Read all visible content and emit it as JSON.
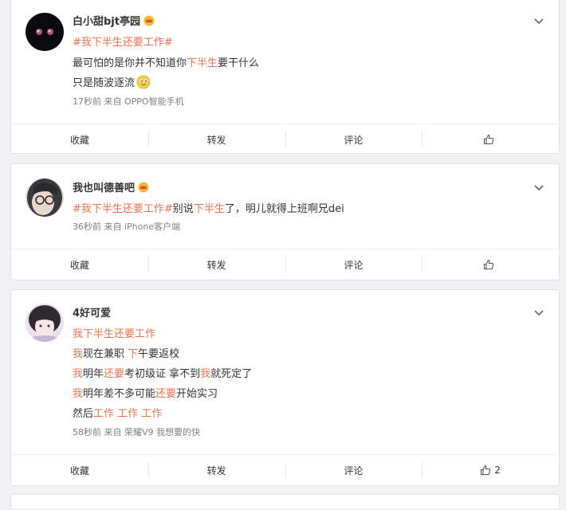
{
  "posts": [
    {
      "name": "白小甜bjt亭园",
      "lines": [
        [
          {
            "t": "#我下半生还要工作#",
            "hl": true
          }
        ],
        [
          {
            "t": "最可怕的是你并不知道你",
            "hl": false
          },
          {
            "t": "下半生",
            "hl": true
          },
          {
            "t": "要干什么",
            "hl": false
          }
        ],
        [
          {
            "t": "只是随波逐流",
            "hl": false
          }
        ]
      ],
      "meta": "17秒前 来自 OPPO智能手机",
      "actions": {
        "collect": "收藏",
        "repost": "转发",
        "comment": "评论",
        "like_count": ""
      }
    },
    {
      "name": "我也叫德善吧",
      "lines": [
        [
          {
            "t": "#我下半生还要工作#",
            "hl": true
          },
          {
            "t": "别说",
            "hl": false
          },
          {
            "t": "下半生",
            "hl": true
          },
          {
            "t": "了，明儿就得上班啊兄dei",
            "hl": false
          }
        ]
      ],
      "meta": "36秒前 来自 iPhone客户端",
      "actions": {
        "collect": "收藏",
        "repost": "转发",
        "comment": "评论",
        "like_count": ""
      }
    },
    {
      "name": "4好可爱",
      "lines": [
        [
          {
            "t": "我下半生还要工作",
            "hl": true
          }
        ],
        [
          {
            "t": "我",
            "hl": true
          },
          {
            "t": "现在兼职 ",
            "hl": false
          },
          {
            "t": "下",
            "hl": true
          },
          {
            "t": "午要返校",
            "hl": false
          }
        ],
        [
          {
            "t": "我",
            "hl": true
          },
          {
            "t": "明年",
            "hl": false
          },
          {
            "t": "还要",
            "hl": true
          },
          {
            "t": "考初级证 拿不到",
            "hl": false
          },
          {
            "t": "我",
            "hl": true
          },
          {
            "t": "就死定了",
            "hl": false
          }
        ],
        [
          {
            "t": "我",
            "hl": true
          },
          {
            "t": "明年差不多可能",
            "hl": false
          },
          {
            "t": "还要",
            "hl": true
          },
          {
            "t": "开始实习",
            "hl": false
          }
        ],
        [
          {
            "t": "然后",
            "hl": false
          },
          {
            "t": "工作 工作 工作",
            "hl": true
          }
        ]
      ],
      "meta": "58秒前 来自 荣耀V9 我想要的快",
      "actions": {
        "collect": "收藏",
        "repost": "转发",
        "comment": "评论",
        "like_count": "2"
      }
    }
  ],
  "colors": {
    "highlight": "#eb7350",
    "background": "#f2f2f5",
    "meta": "#808080"
  }
}
